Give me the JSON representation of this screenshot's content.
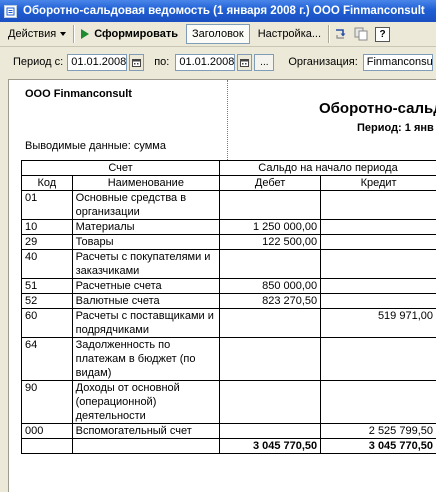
{
  "window": {
    "title": "Оборотно-сальдовая ведомость (1 января 2008 г.) ООО Finmanconsult"
  },
  "toolbar": {
    "actions_label": "Действия",
    "generate_label": "Сформировать",
    "header_label": "Заголовок",
    "settings_label": "Настройка...",
    "help_label": "?"
  },
  "period": {
    "from_label": "Период с:",
    "from_value": "01.01.2008",
    "to_label": "по:",
    "to_value": "01.01.2008",
    "dots_label": "...",
    "org_label": "Организация:",
    "org_value": "Finmanconsult"
  },
  "report": {
    "org": "ООО Finmanconsult",
    "title": "Оборотно-сальд",
    "period": "Период: 1 янв",
    "output": "Выводимые данные: сумма",
    "headers": {
      "account": "Счет",
      "opening_balance": "Сальдо на начало периода",
      "code": "Код",
      "name": "Наименование",
      "debit": "Дебет",
      "credit": "Кредит"
    },
    "rows": [
      {
        "code": "01",
        "name": "Основные средства в организации",
        "debit": "",
        "credit": ""
      },
      {
        "code": "10",
        "name": "Материалы",
        "debit": "1 250 000,00",
        "credit": ""
      },
      {
        "code": "29",
        "name": "Товары",
        "debit": "122 500,00",
        "credit": ""
      },
      {
        "code": "40",
        "name": "Расчеты с покупателями и заказчиками",
        "debit": "",
        "credit": ""
      },
      {
        "code": "51",
        "name": "Расчетные счета",
        "debit": "850 000,00",
        "credit": ""
      },
      {
        "code": "52",
        "name": "Валютные счета",
        "debit": "823 270,50",
        "credit": ""
      },
      {
        "code": "60",
        "name": "Расчеты с поставщиками и подрядчиками",
        "debit": "",
        "credit": "519 971,00"
      },
      {
        "code": "64",
        "name": "Задолженность по платежам в бюджет (по видам)",
        "debit": "",
        "credit": ""
      },
      {
        "code": "90",
        "name": "Доходы от основной (операционной) деятельности",
        "debit": "",
        "credit": ""
      },
      {
        "code": "000",
        "name": "Вспомогательный счет",
        "debit": "",
        "credit": "2 525 799,50"
      }
    ],
    "totals": {
      "debit": "3 045 770,50",
      "credit": "3 045 770,50"
    }
  }
}
